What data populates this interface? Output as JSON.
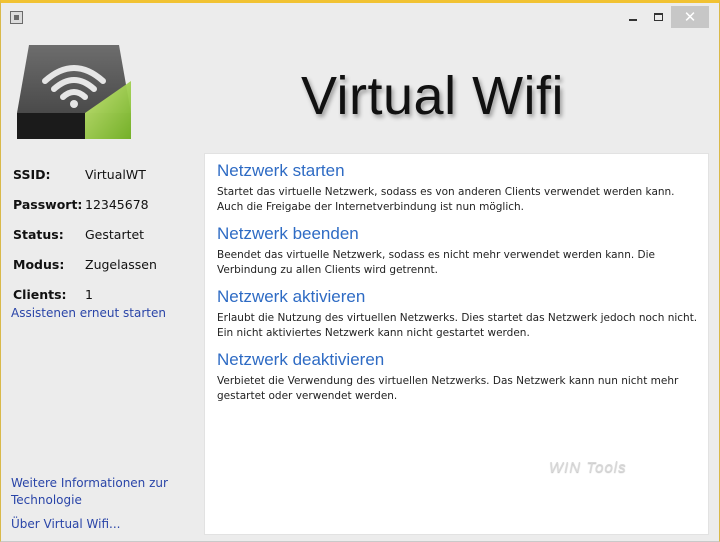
{
  "app": {
    "title": "Virtual Wifi"
  },
  "window_controls": {
    "minimize_icon": "minimize-icon",
    "maximize_icon": "maximize-icon",
    "close_label": "✕"
  },
  "info": [
    {
      "label": "SSID:",
      "value": "VirtualWT"
    },
    {
      "label": "Passwort:",
      "value": "12345678"
    },
    {
      "label": "Status:",
      "value": "Gestartet"
    },
    {
      "label": "Modus:",
      "value": "Zugelassen"
    },
    {
      "label": "Clients:",
      "value": "1"
    }
  ],
  "links": {
    "restart_wizard": "Assistenen erneut starten",
    "more_info": "Weitere Informationen zur Technologie",
    "about": "Über Virtual Wifi..."
  },
  "actions": [
    {
      "title": "Netzwerk starten",
      "desc": "Startet das virtuelle Netzwerk, sodass es von anderen Clients verwendet werden kann. Auch die Freigabe der Internetverbindung ist nun möglich."
    },
    {
      "title": "Netzwerk beenden",
      "desc": "Beendet das virtuelle Netzwerk, sodass es nicht mehr verwendet werden kann. Die Verbindung zu allen Clients wird getrennt."
    },
    {
      "title": "Netzwerk aktivieren",
      "desc": "Erlaubt die Nutzung des virtuellen Netzwerks. Dies startet das Netzwerk jedoch noch nicht. Ein nicht aktiviertes Netzwerk kann nicht gestartet werden."
    },
    {
      "title": "Netzwerk deaktivieren",
      "desc": "Verbietet die Verwendung des virtuellen Netzwerks. Das Netzwerk kann nun nicht mehr gestartet oder verwendet werden."
    }
  ],
  "watermark": "WIN Tools",
  "colors": {
    "accent_link": "#2e6bc4",
    "title_bar_border": "#f1c232",
    "device_green": "#8cc63f"
  }
}
